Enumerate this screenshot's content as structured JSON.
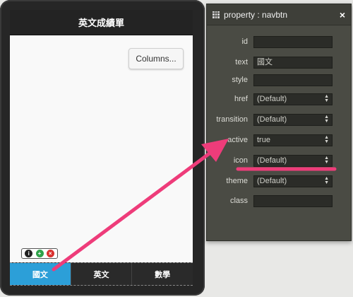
{
  "app": {
    "title": "英文成績單",
    "columns_button": "Columns...",
    "navbar": [
      {
        "label": "國文",
        "active": true
      },
      {
        "label": "英文",
        "active": false
      },
      {
        "label": "數學",
        "active": false
      }
    ],
    "edit_badge": {
      "info": "i",
      "add": "+",
      "delete": "×"
    }
  },
  "panel": {
    "title": "property : navbtn",
    "close_icon": "×",
    "properties": [
      {
        "label": "id",
        "kind": "input",
        "value": ""
      },
      {
        "label": "text",
        "kind": "input",
        "value": "國文"
      },
      {
        "label": "style",
        "kind": "input",
        "value": ""
      },
      {
        "label": "href",
        "kind": "select",
        "value": "(Default)"
      },
      {
        "label": "transition",
        "kind": "select",
        "value": "(Default)"
      },
      {
        "label": "active",
        "kind": "select",
        "value": "true"
      },
      {
        "label": "icon",
        "kind": "select",
        "value": "(Default)"
      },
      {
        "label": "theme",
        "kind": "select",
        "value": "(Default)"
      },
      {
        "label": "class",
        "kind": "input",
        "value": ""
      }
    ]
  },
  "colors": {
    "annotation": "#ee3c7a",
    "active_nav": "#2c9fd8",
    "panel_bg": "#4a4b44"
  }
}
